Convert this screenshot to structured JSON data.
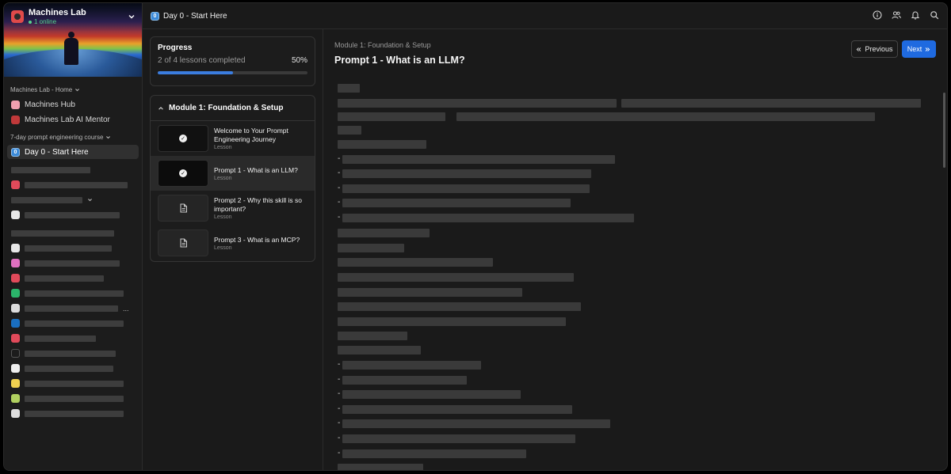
{
  "sidebar": {
    "brand": {
      "name": "Machines Lab",
      "online": "1 online"
    },
    "sections": [
      {
        "label": "Machines Lab - Home"
      },
      {
        "label": "7-day prompt engineering course"
      }
    ],
    "items": [
      {
        "label": "Machines Hub"
      },
      {
        "label": "Machines Lab AI Mentor"
      },
      {
        "label": "Day 0 - Start Here",
        "icon_text": "0"
      }
    ],
    "ellipsis": "..."
  },
  "topbar": {
    "title": "Day 0 - Start Here",
    "icon_text": "0"
  },
  "progress": {
    "title": "Progress",
    "completed_text": "2 of 4 lessons completed",
    "percent_label": "50%",
    "percent": 50
  },
  "module": {
    "title": "Module 1: Foundation & Setup",
    "lessons": [
      {
        "title": "Welcome to Your Prompt Engineering Journey",
        "type": "Lesson",
        "status": "completed"
      },
      {
        "title": "Prompt 1 - What is an LLM?",
        "type": "Lesson",
        "status": "completed"
      },
      {
        "title": "Prompt 2 - Why this skill is so important?",
        "type": "Lesson",
        "status": "not-started"
      },
      {
        "title": "Prompt 3 - What is an MCP?",
        "type": "Lesson",
        "status": "not-started"
      }
    ]
  },
  "content": {
    "module_label": "Module 1: Foundation & Setup",
    "title": "Prompt 1 - What is an LLM?",
    "previous_label": "Previous",
    "next_label": "Next",
    "bullet": "-"
  },
  "colors": {
    "accent": "#1f6ae0",
    "progress_fill": "#3b7de0",
    "online": "#58d68d"
  }
}
